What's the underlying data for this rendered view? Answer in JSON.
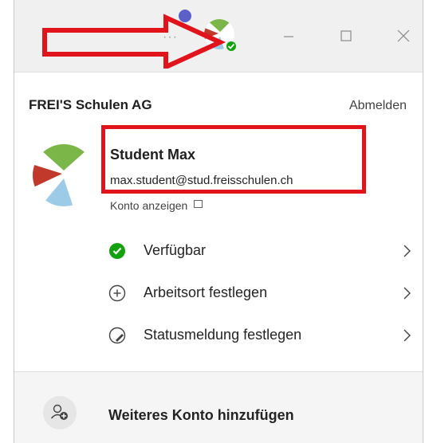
{
  "header": {
    "organization": "FREI'S Schulen AG",
    "sign_out_label": "Abmelden",
    "more_dots": "···"
  },
  "profile": {
    "name": "Student Max",
    "email": "max.student@stud.freisschulen.ch",
    "view_account_label": "Konto anzeigen"
  },
  "menu": {
    "status_label": "Verfügbar",
    "work_location_label": "Arbeitsort festlegen",
    "status_message_label": "Statusmeldung festlegen"
  },
  "footer": {
    "add_account_label": "Weiteres Konto hinzufügen"
  },
  "colors": {
    "annotation_red": "#e1141c",
    "available_green": "#13a10e",
    "presence_dot": "#5b5fc7"
  },
  "icons": [
    "more-icon",
    "avatar-icon",
    "minimize-icon",
    "maximize-icon",
    "close-icon",
    "available-icon",
    "location-icon",
    "status-message-icon",
    "chevron-right-icon",
    "add-person-icon",
    "external-link-icon"
  ]
}
